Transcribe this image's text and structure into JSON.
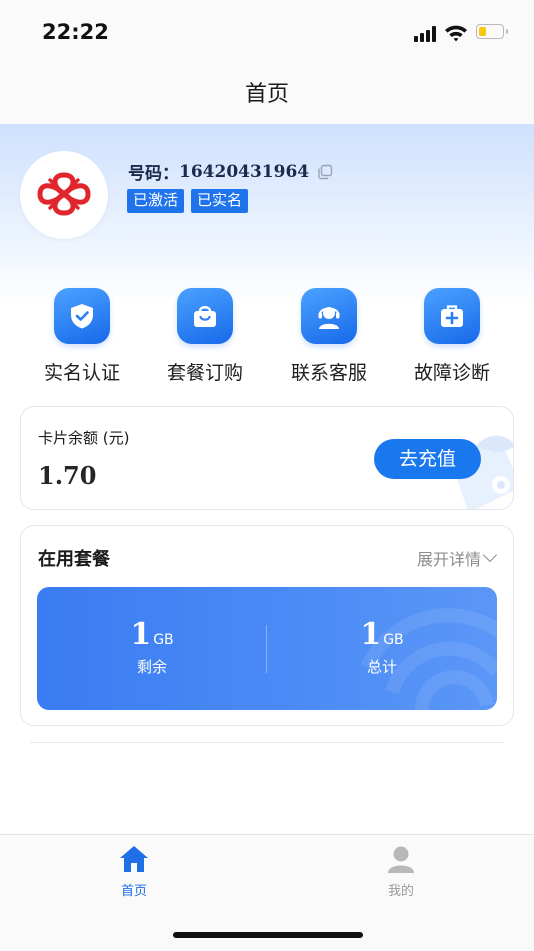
{
  "status_bar": {
    "time": "22:22",
    "battery_level": 0.35
  },
  "nav": {
    "title": "首页"
  },
  "profile": {
    "phone_label": "号码：",
    "phone_number": "16420431964",
    "badges": [
      "已激活",
      "已实名"
    ]
  },
  "quick_actions": [
    {
      "label": "实名认证",
      "icon": "shield-check-icon"
    },
    {
      "label": "套餐订购",
      "icon": "shopping-bag-icon"
    },
    {
      "label": "联系客服",
      "icon": "customer-service-icon"
    },
    {
      "label": "故障诊断",
      "icon": "first-aid-kit-icon"
    }
  ],
  "balance": {
    "label": "卡片余额 (元)",
    "value": "1.70",
    "recharge_label": "去充值"
  },
  "plan": {
    "title": "在用套餐",
    "expand_label": "展开详情",
    "remaining": {
      "value": "1",
      "unit": "GB",
      "caption": "剩余"
    },
    "total": {
      "value": "1",
      "unit": "GB",
      "caption": "总计"
    }
  },
  "tabbar": {
    "items": [
      {
        "label": "首页",
        "icon": "home-icon",
        "active": true
      },
      {
        "label": "我的",
        "icon": "user-icon",
        "active": false
      }
    ]
  },
  "colors": {
    "accent": "#1a78ef",
    "active_tab": "#1f6fe6",
    "inactive_tab": "#9a9a9a",
    "battery": "#f6c80e",
    "logo": "#e0262b"
  }
}
